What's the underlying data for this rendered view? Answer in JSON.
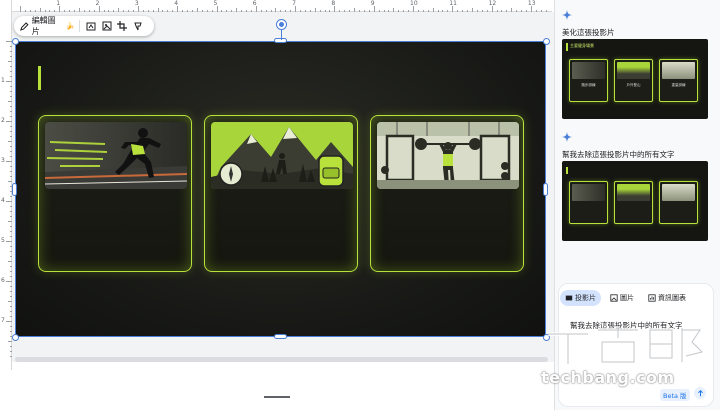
{
  "toolbar": {
    "edit_image_label": "編輯圖片",
    "edit_image_emoji": "🍌",
    "icons": [
      "edit-image-icon",
      "reset-image-icon",
      "replace-image-icon",
      "crop-icon",
      "mask-icon"
    ]
  },
  "ruler": {
    "top_labels": [
      "1",
      "2",
      "3",
      "4",
      "5",
      "6",
      "7",
      "8",
      "9",
      "10",
      "11",
      "12",
      "13"
    ],
    "left_labels": [
      "1",
      "2",
      "3",
      "4",
      "5",
      "6",
      "7"
    ]
  },
  "slide": {
    "cards": [
      {
        "image": "runner",
        "accent": "#b9e13b"
      },
      {
        "image": "mountain-hiker",
        "accent": "#b9e13b"
      },
      {
        "image": "gym",
        "accent": "#b9e13b"
      }
    ]
  },
  "panel": {
    "suggestion_1_title": "美化這張投影片",
    "suggestion_1_thumb_heading": "主要健身場景",
    "suggestion_1_card_titles": [
      "跑步訓練",
      "戶外登山",
      "重量訓練"
    ],
    "suggestion_2_title": "幫我去除這張投影片中的所有文字",
    "tabs": [
      {
        "label": "投影片",
        "icon": "slides-icon",
        "active": true
      },
      {
        "label": "圖片",
        "icon": "image-icon",
        "active": false
      },
      {
        "label": "資訊圖表",
        "icon": "infographic-icon",
        "active": false
      }
    ],
    "prompt_text": "幫我去除這張投影片中的所有文字",
    "beta_label": "Beta 版"
  },
  "watermark": {
    "brand": "T客邦",
    "url": "techbang.com"
  },
  "colors": {
    "accent_green": "#b9e13b",
    "selection_blue": "#4a7fd8",
    "slide_dark": "#171815"
  }
}
